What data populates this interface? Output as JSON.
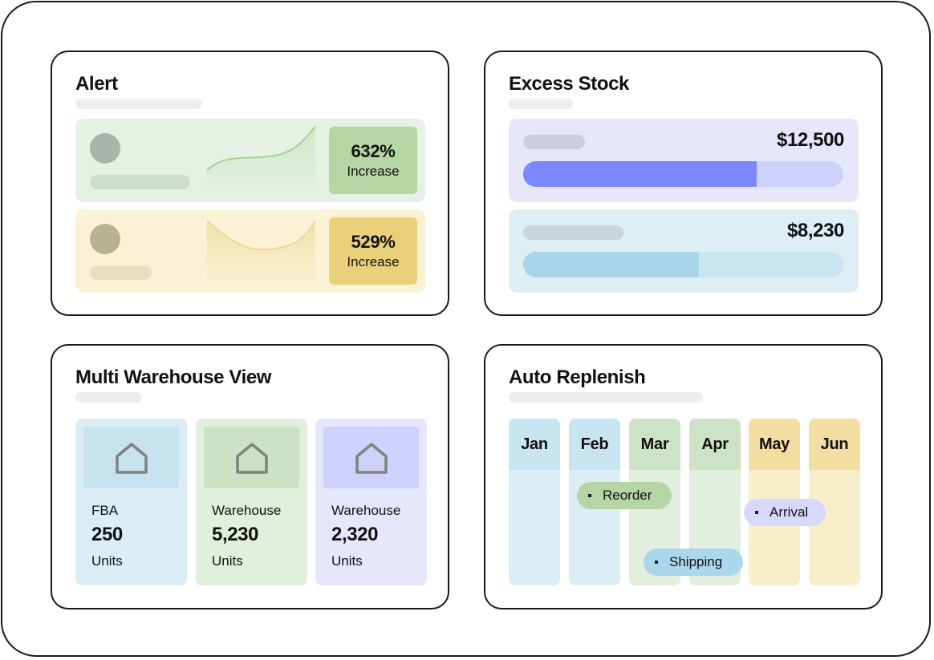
{
  "alert": {
    "title": "Alert",
    "rows": [
      {
        "value": "632%",
        "label": "Increase",
        "bg": "#e4f1e4",
        "badge": "#b4d6a4",
        "dot": "#a9b5aa",
        "skel": "#cdddce",
        "line": "#a6d191"
      },
      {
        "value": "529%",
        "label": "Increase",
        "bg": "#fbf2d6",
        "badge": "#ebd07c",
        "dot": "#b9b291",
        "skel": "#e7dfbd",
        "line": "#ecd89a"
      }
    ]
  },
  "excess": {
    "title": "Excess Stock",
    "rows": [
      {
        "value": "$12,500",
        "fill_fraction": 0.73,
        "bg": "#e7e7fb",
        "track": "#cdd1fb",
        "fill": "#7a88fb",
        "skel": "#cdcde2"
      },
      {
        "value": "$8,230",
        "fill_fraction": 0.55,
        "bg": "#deeef5",
        "track": "#cbe5f0",
        "fill": "#a9d5e8",
        "skel": "#c6d6dc"
      }
    ]
  },
  "warehouse": {
    "title": "Multi Warehouse View",
    "items": [
      {
        "name": "FBA",
        "value": "250",
        "unit": "Units",
        "bg": "#dbeef5",
        "box": "#c6e3ef"
      },
      {
        "name": "Warehouse",
        "value": "5,230",
        "unit": "Units",
        "bg": "#e1efdd",
        "box": "#cbe3c4"
      },
      {
        "name": "Warehouse",
        "value": "2,320",
        "unit": "Units",
        "bg": "#e6e7fd",
        "box": "#cdd1fc"
      }
    ]
  },
  "replenish": {
    "title": "Auto Replenish",
    "months": [
      {
        "label": "Jan",
        "head": "#c8e4f0",
        "body": "#dbeef5"
      },
      {
        "label": "Feb",
        "head": "#c8e4f0",
        "body": "#dbeef5"
      },
      {
        "label": "Mar",
        "head": "#cde3c6",
        "body": "#e2efde"
      },
      {
        "label": "Apr",
        "head": "#cde3c6",
        "body": "#e2efde"
      },
      {
        "label": "May",
        "head": "#f3dea1",
        "body": "#f8eecc"
      },
      {
        "label": "Jun",
        "head": "#f3dea1",
        "body": "#f8eecc"
      }
    ],
    "events": [
      {
        "label": "Reorder",
        "color": "#b4d6a4"
      },
      {
        "label": "Arrival",
        "color": "#d6d9fb"
      },
      {
        "label": "Shipping",
        "color": "#acd6ec"
      }
    ]
  },
  "icons": {
    "warehouse": "home-icon"
  }
}
